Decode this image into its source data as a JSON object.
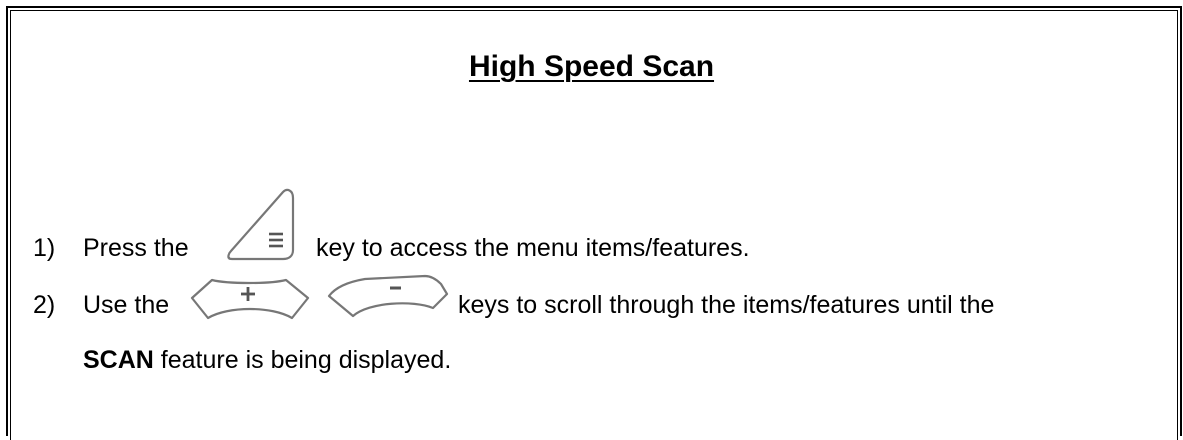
{
  "document": {
    "title": "High Speed Scan",
    "steps": [
      {
        "number": "1)",
        "before_icon": "Press the",
        "icon": "menu-key-icon",
        "after_icon": "key to access the menu items/features."
      },
      {
        "number": "2)",
        "before_icon": "Use the",
        "icons": [
          "plus-key-icon",
          "minus-key-icon"
        ],
        "after_icon": "keys to scroll through the items/features until the",
        "continuation_bold": "SCAN",
        "continuation_rest": "feature is being displayed."
      }
    ]
  }
}
